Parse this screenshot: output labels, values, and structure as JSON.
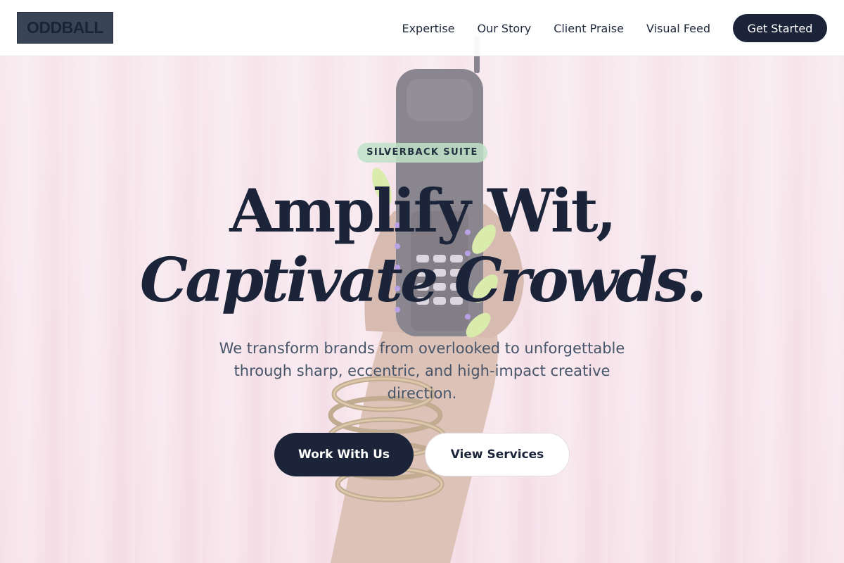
{
  "brand": {
    "logo_text": "ODDBALL"
  },
  "nav": {
    "links": [
      {
        "label": "Expertise"
      },
      {
        "label": "Our Story"
      },
      {
        "label": "Client Praise"
      },
      {
        "label": "Visual Feed"
      }
    ],
    "cta_label": "Get Started"
  },
  "hero": {
    "badge": "SILVERBACK SUITE",
    "headline_line1": "Amplify Wit,",
    "headline_line2": "Captivate Crowds.",
    "subtext": "We transform brands from overlooked to unforgettable through sharp, eccentric, and high-impact creative direction.",
    "primary_button": "Work With Us",
    "secondary_button": "View Services"
  },
  "colors": {
    "navy": "#1b2438",
    "badge_green": "#bee2c8",
    "curtain_pink": "#f5e1e8",
    "body_text": "#475569"
  }
}
